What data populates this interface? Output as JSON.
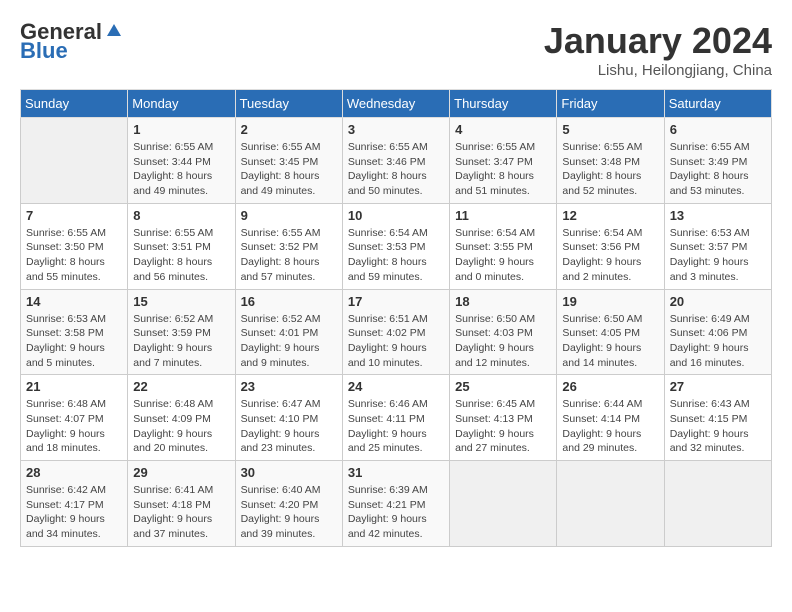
{
  "header": {
    "logo_general": "General",
    "logo_blue": "Blue",
    "month_title": "January 2024",
    "location": "Lishu, Heilongjiang, China"
  },
  "days_of_week": [
    "Sunday",
    "Monday",
    "Tuesday",
    "Wednesday",
    "Thursday",
    "Friday",
    "Saturday"
  ],
  "weeks": [
    [
      {
        "day": "",
        "sunrise": "",
        "sunset": "",
        "daylight": "",
        "empty": true
      },
      {
        "day": "1",
        "sunrise": "Sunrise: 6:55 AM",
        "sunset": "Sunset: 3:44 PM",
        "daylight": "Daylight: 8 hours and 49 minutes."
      },
      {
        "day": "2",
        "sunrise": "Sunrise: 6:55 AM",
        "sunset": "Sunset: 3:45 PM",
        "daylight": "Daylight: 8 hours and 49 minutes."
      },
      {
        "day": "3",
        "sunrise": "Sunrise: 6:55 AM",
        "sunset": "Sunset: 3:46 PM",
        "daylight": "Daylight: 8 hours and 50 minutes."
      },
      {
        "day": "4",
        "sunrise": "Sunrise: 6:55 AM",
        "sunset": "Sunset: 3:47 PM",
        "daylight": "Daylight: 8 hours and 51 minutes."
      },
      {
        "day": "5",
        "sunrise": "Sunrise: 6:55 AM",
        "sunset": "Sunset: 3:48 PM",
        "daylight": "Daylight: 8 hours and 52 minutes."
      },
      {
        "day": "6",
        "sunrise": "Sunrise: 6:55 AM",
        "sunset": "Sunset: 3:49 PM",
        "daylight": "Daylight: 8 hours and 53 minutes."
      }
    ],
    [
      {
        "day": "7",
        "sunrise": "Sunrise: 6:55 AM",
        "sunset": "Sunset: 3:50 PM",
        "daylight": "Daylight: 8 hours and 55 minutes."
      },
      {
        "day": "8",
        "sunrise": "Sunrise: 6:55 AM",
        "sunset": "Sunset: 3:51 PM",
        "daylight": "Daylight: 8 hours and 56 minutes."
      },
      {
        "day": "9",
        "sunrise": "Sunrise: 6:55 AM",
        "sunset": "Sunset: 3:52 PM",
        "daylight": "Daylight: 8 hours and 57 minutes."
      },
      {
        "day": "10",
        "sunrise": "Sunrise: 6:54 AM",
        "sunset": "Sunset: 3:53 PM",
        "daylight": "Daylight: 8 hours and 59 minutes."
      },
      {
        "day": "11",
        "sunrise": "Sunrise: 6:54 AM",
        "sunset": "Sunset: 3:55 PM",
        "daylight": "Daylight: 9 hours and 0 minutes."
      },
      {
        "day": "12",
        "sunrise": "Sunrise: 6:54 AM",
        "sunset": "Sunset: 3:56 PM",
        "daylight": "Daylight: 9 hours and 2 minutes."
      },
      {
        "day": "13",
        "sunrise": "Sunrise: 6:53 AM",
        "sunset": "Sunset: 3:57 PM",
        "daylight": "Daylight: 9 hours and 3 minutes."
      }
    ],
    [
      {
        "day": "14",
        "sunrise": "Sunrise: 6:53 AM",
        "sunset": "Sunset: 3:58 PM",
        "daylight": "Daylight: 9 hours and 5 minutes."
      },
      {
        "day": "15",
        "sunrise": "Sunrise: 6:52 AM",
        "sunset": "Sunset: 3:59 PM",
        "daylight": "Daylight: 9 hours and 7 minutes."
      },
      {
        "day": "16",
        "sunrise": "Sunrise: 6:52 AM",
        "sunset": "Sunset: 4:01 PM",
        "daylight": "Daylight: 9 hours and 9 minutes."
      },
      {
        "day": "17",
        "sunrise": "Sunrise: 6:51 AM",
        "sunset": "Sunset: 4:02 PM",
        "daylight": "Daylight: 9 hours and 10 minutes."
      },
      {
        "day": "18",
        "sunrise": "Sunrise: 6:50 AM",
        "sunset": "Sunset: 4:03 PM",
        "daylight": "Daylight: 9 hours and 12 minutes."
      },
      {
        "day": "19",
        "sunrise": "Sunrise: 6:50 AM",
        "sunset": "Sunset: 4:05 PM",
        "daylight": "Daylight: 9 hours and 14 minutes."
      },
      {
        "day": "20",
        "sunrise": "Sunrise: 6:49 AM",
        "sunset": "Sunset: 4:06 PM",
        "daylight": "Daylight: 9 hours and 16 minutes."
      }
    ],
    [
      {
        "day": "21",
        "sunrise": "Sunrise: 6:48 AM",
        "sunset": "Sunset: 4:07 PM",
        "daylight": "Daylight: 9 hours and 18 minutes."
      },
      {
        "day": "22",
        "sunrise": "Sunrise: 6:48 AM",
        "sunset": "Sunset: 4:09 PM",
        "daylight": "Daylight: 9 hours and 20 minutes."
      },
      {
        "day": "23",
        "sunrise": "Sunrise: 6:47 AM",
        "sunset": "Sunset: 4:10 PM",
        "daylight": "Daylight: 9 hours and 23 minutes."
      },
      {
        "day": "24",
        "sunrise": "Sunrise: 6:46 AM",
        "sunset": "Sunset: 4:11 PM",
        "daylight": "Daylight: 9 hours and 25 minutes."
      },
      {
        "day": "25",
        "sunrise": "Sunrise: 6:45 AM",
        "sunset": "Sunset: 4:13 PM",
        "daylight": "Daylight: 9 hours and 27 minutes."
      },
      {
        "day": "26",
        "sunrise": "Sunrise: 6:44 AM",
        "sunset": "Sunset: 4:14 PM",
        "daylight": "Daylight: 9 hours and 29 minutes."
      },
      {
        "day": "27",
        "sunrise": "Sunrise: 6:43 AM",
        "sunset": "Sunset: 4:15 PM",
        "daylight": "Daylight: 9 hours and 32 minutes."
      }
    ],
    [
      {
        "day": "28",
        "sunrise": "Sunrise: 6:42 AM",
        "sunset": "Sunset: 4:17 PM",
        "daylight": "Daylight: 9 hours and 34 minutes."
      },
      {
        "day": "29",
        "sunrise": "Sunrise: 6:41 AM",
        "sunset": "Sunset: 4:18 PM",
        "daylight": "Daylight: 9 hours and 37 minutes."
      },
      {
        "day": "30",
        "sunrise": "Sunrise: 6:40 AM",
        "sunset": "Sunset: 4:20 PM",
        "daylight": "Daylight: 9 hours and 39 minutes."
      },
      {
        "day": "31",
        "sunrise": "Sunrise: 6:39 AM",
        "sunset": "Sunset: 4:21 PM",
        "daylight": "Daylight: 9 hours and 42 minutes."
      },
      {
        "day": "",
        "sunrise": "",
        "sunset": "",
        "daylight": "",
        "empty": true
      },
      {
        "day": "",
        "sunrise": "",
        "sunset": "",
        "daylight": "",
        "empty": true
      },
      {
        "day": "",
        "sunrise": "",
        "sunset": "",
        "daylight": "",
        "empty": true
      }
    ]
  ]
}
